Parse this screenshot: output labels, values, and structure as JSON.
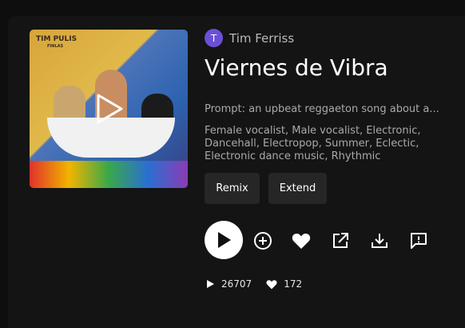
{
  "cover": {
    "logo_text": "TIM PULIS",
    "logo_sub": "FINLAS",
    "play_icon": "play-triangle-outline"
  },
  "artist": {
    "avatar_letter": "T",
    "avatar_color": "#6b4fd8",
    "name": "Tim Ferriss"
  },
  "song": {
    "title": "Viernes de Vibra",
    "prompt": "Prompt: an upbeat reggaeton song about a...",
    "tags": "Female vocalist, Male vocalist, Electronic, Dancehall, Electropop, Summer, Eclectic, Electronic dance music, Rhythmic"
  },
  "actions": {
    "remix_label": "Remix",
    "extend_label": "Extend",
    "icons": [
      "play-icon",
      "add-icon",
      "heart-icon",
      "share-icon",
      "download-icon",
      "report-icon"
    ]
  },
  "stats": {
    "plays": "26707",
    "likes": "172"
  }
}
